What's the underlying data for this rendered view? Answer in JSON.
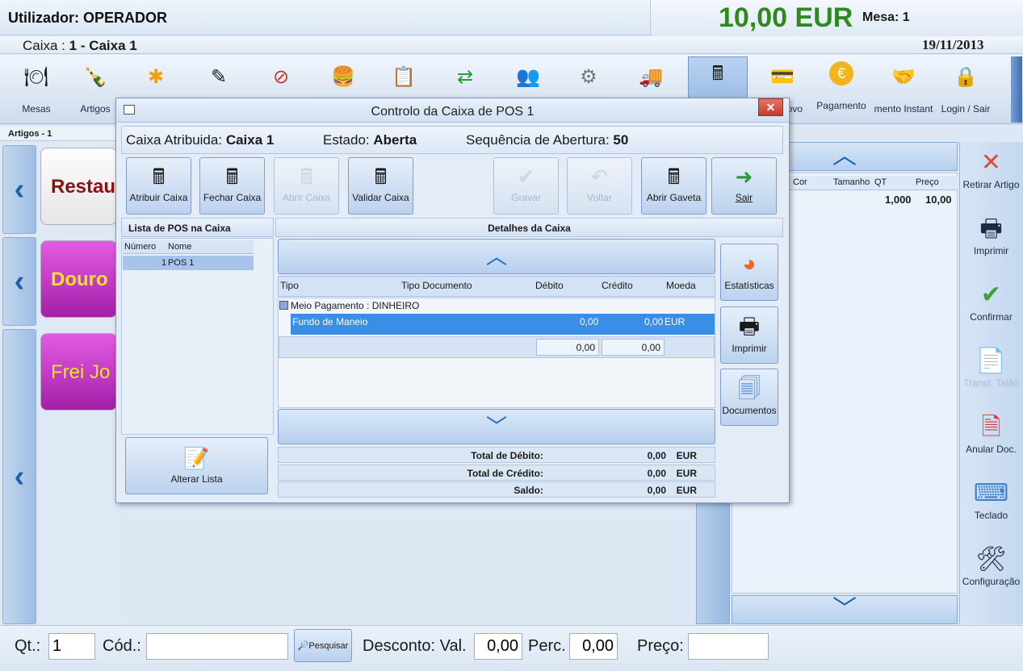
{
  "header": {
    "user": "Utilizador: OPERADOR",
    "total": "10,00 EUR",
    "mesa": "Mesa: 1",
    "caixa_prefix": "Caixa : ",
    "caixa_name": "1 - Caixa 1",
    "date": "19/11/2013"
  },
  "toolbar": {
    "items": [
      {
        "label": "Mesas",
        "icon": "table-icon"
      },
      {
        "label": "Artigos",
        "icon": "bottle-icon"
      },
      {
        "label": "",
        "icon": "asterisk-icon"
      },
      {
        "label": "",
        "icon": "edit-icon"
      },
      {
        "label": "",
        "icon": "cancel-icon"
      },
      {
        "label": "",
        "icon": "food-icon"
      },
      {
        "label": "",
        "icon": "document-icon"
      },
      {
        "label": "",
        "icon": "transfer-icon"
      },
      {
        "label": "",
        "icon": "users-icon"
      },
      {
        "label": "",
        "icon": "gear-icon"
      },
      {
        "label": "",
        "icon": "truck-icon"
      },
      {
        "label": "",
        "icon": "cash-register-icon"
      },
      {
        "label": "ovo",
        "icon": "cards-icon"
      },
      {
        "label": "Pagamento",
        "icon": "euro-icon"
      },
      {
        "label": "mento Instant",
        "icon": "handshake-icon"
      },
      {
        "label": "Login / Sair",
        "icon": "lock-icon"
      }
    ]
  },
  "left": {
    "title": "Artigos - 1",
    "categories": [
      {
        "label": "Restau",
        "color": "#8b1010"
      },
      {
        "label": "Douro",
        "color": "#f2e12a"
      },
      {
        "label": "Frei Jo",
        "color": "#f2e12a"
      }
    ]
  },
  "order": {
    "columns": [
      "Cor",
      "Tamanho",
      "QT",
      "Preço"
    ],
    "row": {
      "qt": "1,000",
      "preco": "10,00"
    }
  },
  "side": {
    "buttons": [
      "Retirar Artigo",
      "Imprimir",
      "Confirmar",
      "Transf. Talão",
      "Anular Doc.",
      "Teclado",
      "Configuração"
    ]
  },
  "bottom": {
    "qt_label": "Qt.:",
    "qt_value": "1",
    "cod_label": "Cód.:",
    "pesquisar": "Pesquisar",
    "desconto_label": "Desconto: Val.",
    "desconto_val": "0,00",
    "perc_label": "Perc.",
    "perc_val": "0,00",
    "preco_label": "Preço:"
  },
  "dialog": {
    "title": "Controlo da Caixa de POS 1",
    "caixa_label": "Caixa Atribuida:",
    "caixa_value": "Caixa 1",
    "estado_label": "Estado:",
    "estado_value": "Aberta",
    "seq_label": "Sequência de Abertura:",
    "seq_value": "50",
    "buttons": {
      "atribuir": "Atribuir Caixa",
      "fechar": "Fechar Caixa",
      "abrir": "Abrir Caixa",
      "validar": "Validar Caixa",
      "gravar": "Gravar",
      "voltar": "Voltar",
      "gaveta": "Abrir Gaveta",
      "sair": "Sair"
    },
    "pos_list_title": "Lista de POS na Caixa",
    "pos_columns": [
      "Número",
      "Nome"
    ],
    "pos_rows": [
      {
        "numero": "1",
        "nome": "POS 1"
      }
    ],
    "alterar": "Alterar Lista",
    "details_title": "Detalhes da Caixa",
    "det_columns": [
      "Tipo",
      "Tipo Documento",
      "Débito",
      "Crédito",
      "Moeda"
    ],
    "group": "Meio Pagamento : DINHEIRO",
    "fundo": {
      "tipo": "Fundo de Maneio",
      "debito": "0,00",
      "credito": "0,00",
      "moeda": "EUR"
    },
    "sum_debito": "0,00",
    "sum_credito": "0,00",
    "totals": [
      {
        "label": "Total de Débito:",
        "value": "0,00",
        "currency": "EUR"
      },
      {
        "label": "Total de Crédito:",
        "value": "0,00",
        "currency": "EUR"
      },
      {
        "label": "Saldo:",
        "value": "0,00",
        "currency": "EUR"
      }
    ],
    "side_buttons": {
      "estatisticas": "Estatísticas",
      "imprimir": "Imprimir",
      "documentos": "Documentos"
    }
  }
}
